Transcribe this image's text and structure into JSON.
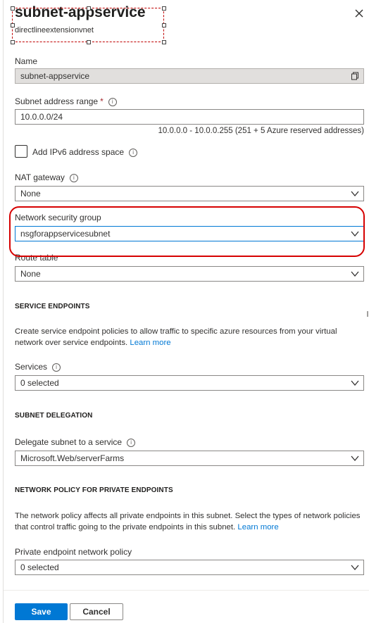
{
  "header": {
    "title": "subnet-appservice",
    "subtitle": "directlineextensionvnet"
  },
  "name_field": {
    "label": "Name",
    "value": "subnet-appservice"
  },
  "address_range": {
    "label": "Subnet address range",
    "required_mark": "*",
    "value": "10.0.0.0/24",
    "hint": "10.0.0.0 - 10.0.0.255 (251 + 5 Azure reserved addresses)"
  },
  "ipv6": {
    "label": "Add IPv6 address space",
    "checked": false
  },
  "nat_gateway": {
    "label": "NAT gateway",
    "value": "None"
  },
  "nsg": {
    "label": "Network security group",
    "value": "nsgforappservicesubnet"
  },
  "route_table": {
    "label": "Route table",
    "value": "None"
  },
  "service_endpoints": {
    "heading": "SERVICE ENDPOINTS",
    "description": "Create service endpoint policies to allow traffic to specific azure resources from your virtual network over service endpoints.",
    "link": "Learn more",
    "services_label": "Services",
    "services_value": "0 selected"
  },
  "subnet_delegation": {
    "heading": "SUBNET DELEGATION",
    "label": "Delegate subnet to a service",
    "value": "Microsoft.Web/serverFarms"
  },
  "private_endpoints": {
    "heading": "NETWORK POLICY FOR PRIVATE ENDPOINTS",
    "description": "The network policy affects all private endpoints in this subnet. Select the types of network policies that control traffic going to the private endpoints in this subnet.",
    "link": "Learn more",
    "label": "Private endpoint network policy",
    "value": "0 selected"
  },
  "footer": {
    "save_label": "Save",
    "cancel_label": "Cancel"
  },
  "icons": {
    "info": "info-icon",
    "chevron": "chevron-down-icon",
    "copy": "copy-icon",
    "close": "close-icon"
  },
  "colors": {
    "accent": "#0078d4",
    "annotation_red": "#d60000"
  }
}
